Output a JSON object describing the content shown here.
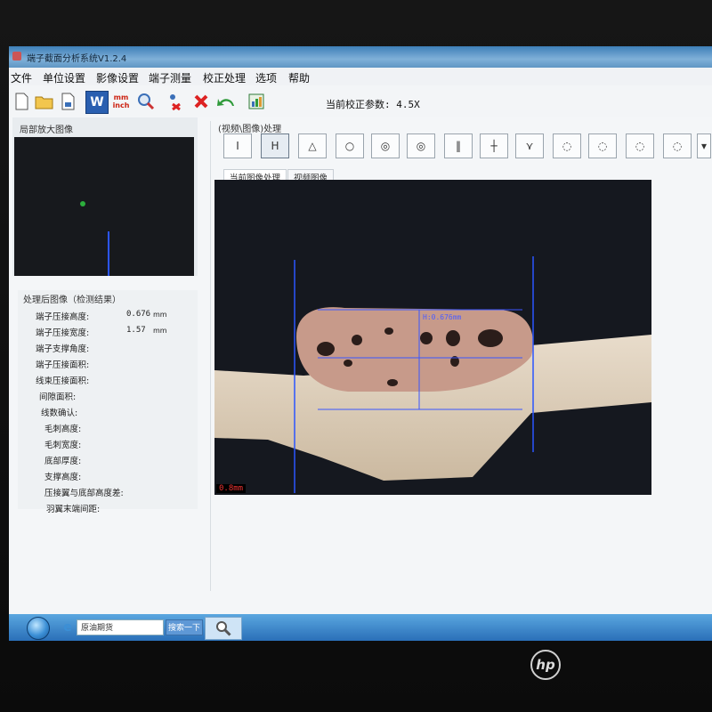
{
  "app": {
    "title": "端子截面分析系统V1.2.4",
    "calibration_text": "当前校正参数: 4.5X"
  },
  "menu": [
    "文件",
    "单位设置",
    "影像设置",
    "端子测量",
    "校正处理",
    "选项",
    "帮助"
  ],
  "toolbar": {
    "icons": [
      "new-file-icon",
      "open-folder-icon",
      "save-icon",
      "word-export-icon",
      "unit-toggle-icon",
      "search-zoom-icon",
      "delete-measure-icon",
      "close-icon",
      "undo-icon",
      "excel-export-icon"
    ],
    "unit_top": "mm",
    "unit_bottom": "inch",
    "word_letter": "W"
  },
  "zoom_panel": {
    "title": "局部放大图像"
  },
  "results": {
    "title": "处理后图像（检测结果）",
    "rows": [
      {
        "label": "端子压接高度:",
        "value": "0.676",
        "unit": "mm"
      },
      {
        "label": "端子压接宽度:",
        "value": "1.57",
        "unit": "mm"
      },
      {
        "label": "端子支撑角度:",
        "value": "",
        "unit": ""
      },
      {
        "label": "端子压接面积:",
        "value": "",
        "unit": ""
      },
      {
        "label": "线束压接面积:",
        "value": "",
        "unit": ""
      },
      {
        "label": "间隙面积:",
        "value": "",
        "unit": ""
      },
      {
        "label": "线数确认:",
        "value": "",
        "unit": ""
      },
      {
        "label": "毛刺高度:",
        "value": "",
        "unit": ""
      },
      {
        "label": "毛刺宽度:",
        "value": "",
        "unit": ""
      },
      {
        "label": "底部厚度:",
        "value": "",
        "unit": ""
      },
      {
        "label": "支撑高度:",
        "value": "",
        "unit": ""
      },
      {
        "label": "压接翼与底部高度差:",
        "value": "",
        "unit": ""
      },
      {
        "label": "羽翼末端间距:",
        "value": "",
        "unit": ""
      }
    ]
  },
  "processing": {
    "title": "(视频\\图像)处理",
    "tools": [
      "I-beam-icon",
      "H-measure-icon",
      "angle-icon",
      "contour-icon",
      "shape-double-icon",
      "shape-nested-icon",
      "gap-lines-icon",
      "cross-line-icon",
      "wing-icon",
      "crimp-full-icon",
      "crimp-strands-icon",
      "crimp-outline-icon",
      "crimp-solid-icon",
      "color-picker-icon"
    ],
    "tool_glyphs": [
      "I",
      "H",
      "△",
      "○",
      "◎",
      "◎",
      "‖",
      "┼",
      "⋎",
      "◌",
      "◌",
      "◌",
      "◌",
      "▾"
    ],
    "tabs": [
      "当前图像处理",
      "视频图像"
    ],
    "measure_label": "H:0.676mm",
    "scale_label": "0.8mm"
  },
  "taskbar": {
    "search_text": "原油期货",
    "search_button": "搜索一下"
  },
  "monitor": {
    "brand": "hp"
  }
}
